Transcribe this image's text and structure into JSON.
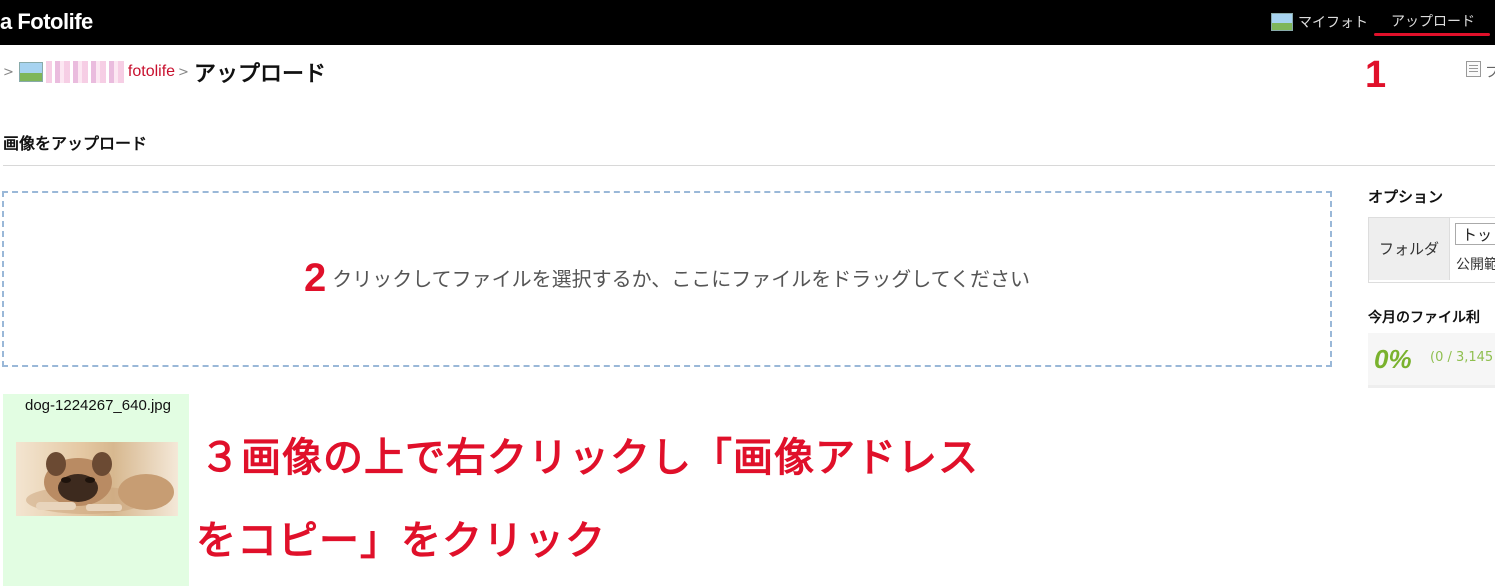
{
  "topbar": {
    "logo": "a Fotolife",
    "my_photo_label": "マイフォト",
    "upload_label": "アップロード",
    "icons": [
      "photo-icon"
    ],
    "accent_color": "#e0102a"
  },
  "breadcrumb": {
    "separator": ">",
    "site_link": "fotolife",
    "current": "アップロード"
  },
  "markers": {
    "step1": "1",
    "step2": "2"
  },
  "page": {
    "section_heading": "画像をアップロード",
    "right_cut_text": "フ"
  },
  "dropzone": {
    "text": "クリックしてファイルを選択するか、ここにファイルをドラッグしてください"
  },
  "options": {
    "heading": "オプション",
    "folder_label": "フォルダ",
    "folder_value": "トッ",
    "public_label": "公開範",
    "usage_heading": "今月のファイル利",
    "usage_percent": "0%",
    "usage_quota": "(0 / 3,145"
  },
  "upload_item": {
    "filename": "dog-1224267_640.jpg"
  },
  "instructions": {
    "line1": "３画像の上で右クリックし「画像アドレス",
    "line2": "をコピー」をクリック"
  }
}
